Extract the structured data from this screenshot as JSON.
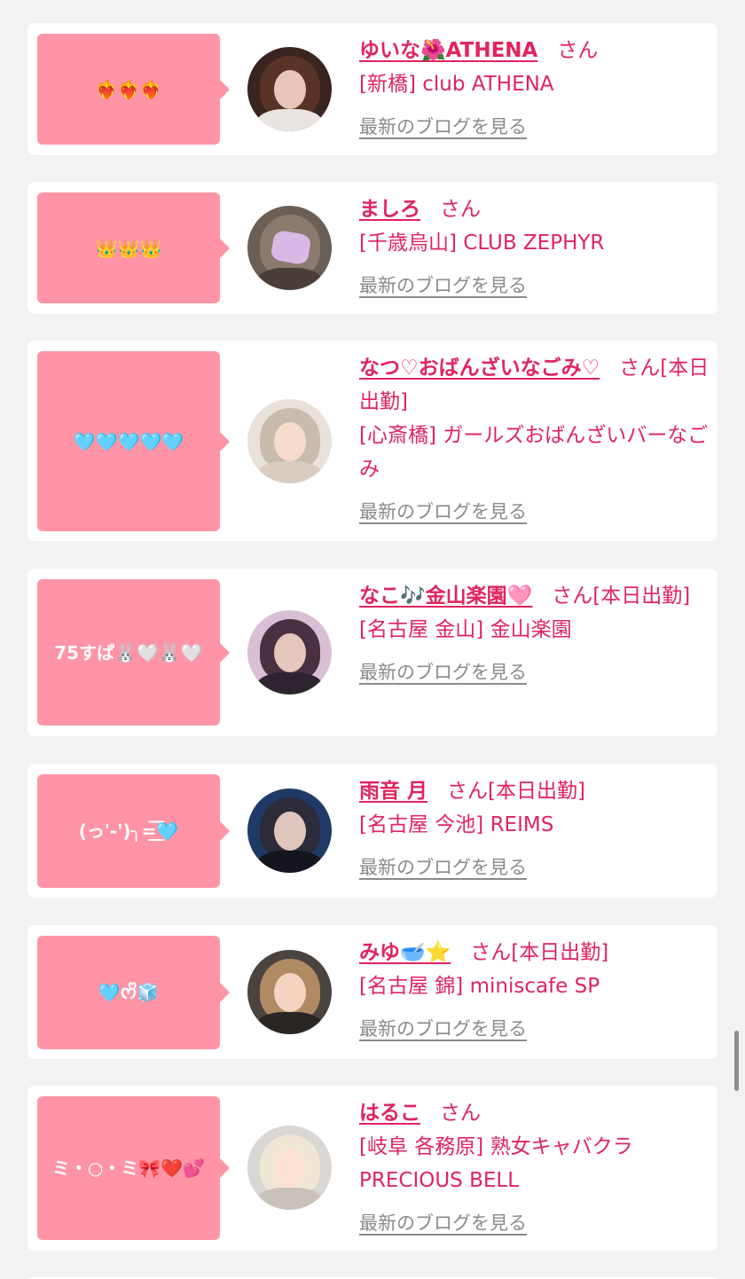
{
  "blog_link_label": "最新のブログを見る",
  "honorific": "さん",
  "colors": {
    "bubble": "#ff94a6",
    "accent": "#e0245e",
    "link_gray": "#8a8a8a",
    "background": "#f2f2f2"
  },
  "entries": [
    {
      "bubble_text": "❤️‍🔥❤️‍🔥❤️‍🔥",
      "name": "ゆいな🌺ATHENA",
      "status": "",
      "shop": "[新橋] club ATHENA",
      "avatar_icon": "avatar-photo"
    },
    {
      "bubble_text": "👑👑👑",
      "name": "ましろ",
      "status": "",
      "shop": "[千歳烏山] CLUB ZEPHYR",
      "avatar_icon": "avatar-photo-secret"
    },
    {
      "bubble_text": "🩵🩵🩵🩵🩵",
      "name": "なつ♡おばんざいなごみ♡",
      "status": "[本日出勤]",
      "shop": "[心斎橋] ガールズおばんざいバーなごみ",
      "avatar_icon": "avatar-photo-bear-hood"
    },
    {
      "bubble_text": "75すぱ🐰🤍🐰🤍",
      "name": "なこ🎶金山楽園🩷",
      "status": "[本日出勤]",
      "shop": "[名古屋 金山] 金山楽園",
      "avatar_icon": "avatar-photo"
    },
    {
      "bubble_text": "(っ'-')╮=͟͟͞͞🩵",
      "name": "雨音 月",
      "status": "[本日出勤]",
      "shop": "[名古屋 今池] REIMS",
      "avatar_icon": "avatar-photo"
    },
    {
      "bubble_text": "🩵ᰔᩚ🧊",
      "name": "みゆ🥣⭐️",
      "status": "[本日出勤]",
      "shop": "[名古屋 錦] miniscafe SP",
      "avatar_icon": "avatar-photo"
    },
    {
      "bubble_text": "ミ・○・ミ🎀❤️💕",
      "name": "はるこ",
      "status": "",
      "shop": "[岐阜 各務原]  熟女キャバクラ PRECIOUS BELL",
      "avatar_icon": "avatar-photo"
    }
  ]
}
